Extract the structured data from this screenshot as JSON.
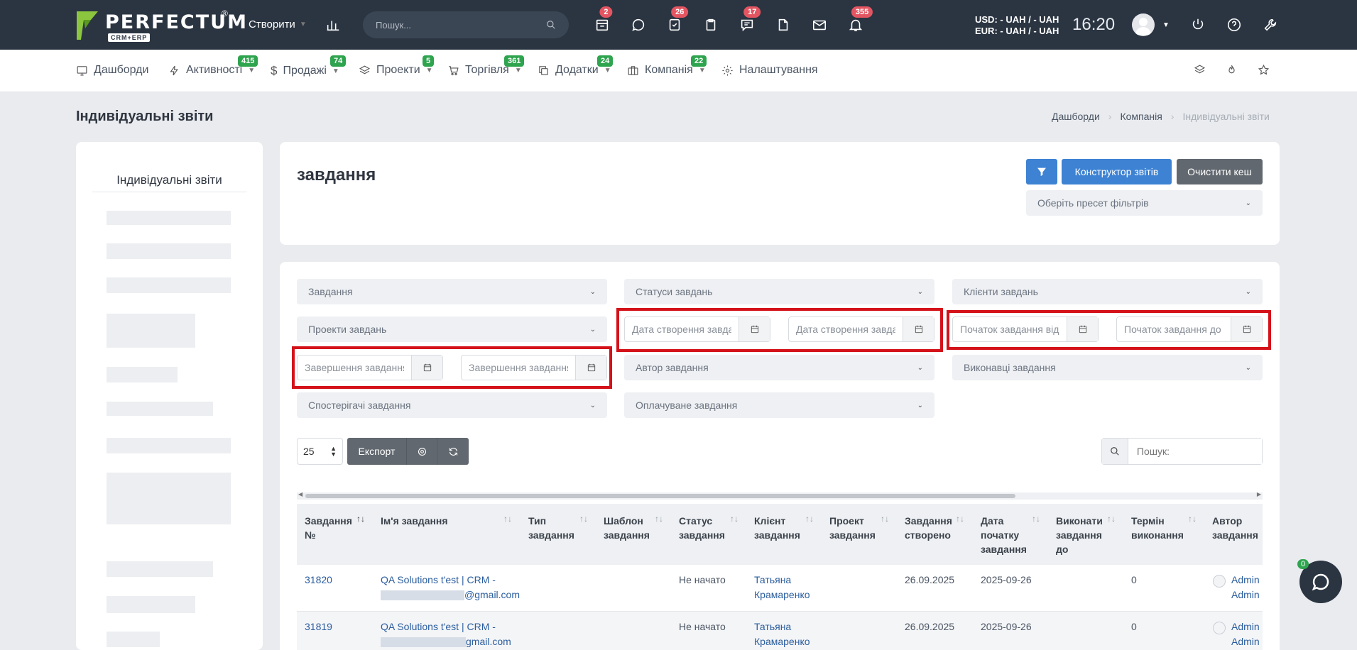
{
  "header": {
    "logo_text": "PERFECTUM",
    "logo_sub": "CRM+ERP",
    "logo_reg": "®",
    "create_label": "Створити",
    "search_placeholder": "Пошук...",
    "badges": [
      "2",
      "26",
      "17",
      "355"
    ],
    "currency_usd": "USD: - UAH / - UAH",
    "currency_eur": "EUR: - UAH / - UAH",
    "time": "16:20"
  },
  "nav": {
    "items": [
      {
        "label": "Дашборди",
        "badge": ""
      },
      {
        "label": "Активності",
        "badge": "415"
      },
      {
        "label": "Продажі",
        "badge": "74"
      },
      {
        "label": "Проекти",
        "badge": "5"
      },
      {
        "label": "Торгівля",
        "badge": "361"
      },
      {
        "label": "Додатки",
        "badge": "24"
      },
      {
        "label": "Компанія",
        "badge": "22"
      },
      {
        "label": "Налаштування",
        "badge": ""
      }
    ]
  },
  "page": {
    "title": "Індивідуальні звіти",
    "breadcrumb": [
      "Дашборди",
      "Компанія",
      "Індивідуальні звіти"
    ]
  },
  "sidebar": {
    "title": "Індивідуальні звіти"
  },
  "report": {
    "title": "завдання",
    "constructor_label": "Конструктор звітів",
    "clear_cache_label": "Очистити кеш",
    "preset_placeholder": "Оберіть пресет фільтрів"
  },
  "filters": {
    "tasks": "Завдання",
    "statuses": "Статуси завдань",
    "clients": "Клієнти завдань",
    "projects": "Проекти завдань",
    "created_from": "Дата створення завдання від",
    "created_to": "Дата створення завдання до",
    "start_from": "Початок завдання від",
    "start_to": "Початок завдання до",
    "end_from": "Завершення завдання від",
    "end_to": "Завершення завдання до",
    "author": "Автор завдання",
    "executors": "Виконавці завдання",
    "observers": "Спостерігачі завдання",
    "paid": "Оплачуване завдання"
  },
  "table_controls": {
    "page_size": "25",
    "export_label": "Експорт",
    "search_placeholder": "Пошук:"
  },
  "table": {
    "headers": [
      "Завдання №",
      "Ім'я завдання",
      "Тип завдання",
      "Шаблон завдання",
      "Статус завдання",
      "Клієнт завдання",
      "Проект завдання",
      "Завдання створено",
      "Дата початку завдання",
      "Виконати завдання до",
      "Термін виконання",
      "Автор завдання"
    ],
    "rows": [
      {
        "id": "31820",
        "name_line1": "QA Solutions t'est | CRM -",
        "name_line2": "@gmail.com",
        "type": "",
        "template": "",
        "status": "Не начато",
        "client_line1": "Татьяна",
        "client_line2": "Крамаренко",
        "project": "",
        "created": "26.09.2025",
        "start": "2025-09-26",
        "due": "",
        "term": "0",
        "author_line1": "Admin",
        "author_line2": "Admin"
      },
      {
        "id": "31819",
        "name_line1": "QA Solutions t'est | CRM -",
        "name_line2": "gmail.com",
        "type": "",
        "template": "",
        "status": "Не начато",
        "client_line1": "Татьяна",
        "client_line2": "Крамаренко",
        "project": "",
        "created": "26.09.2025",
        "start": "2025-09-26",
        "due": "",
        "term": "0",
        "author_line1": "Admin",
        "author_line2": "Admin"
      }
    ]
  },
  "chat": {
    "badge": "0"
  }
}
